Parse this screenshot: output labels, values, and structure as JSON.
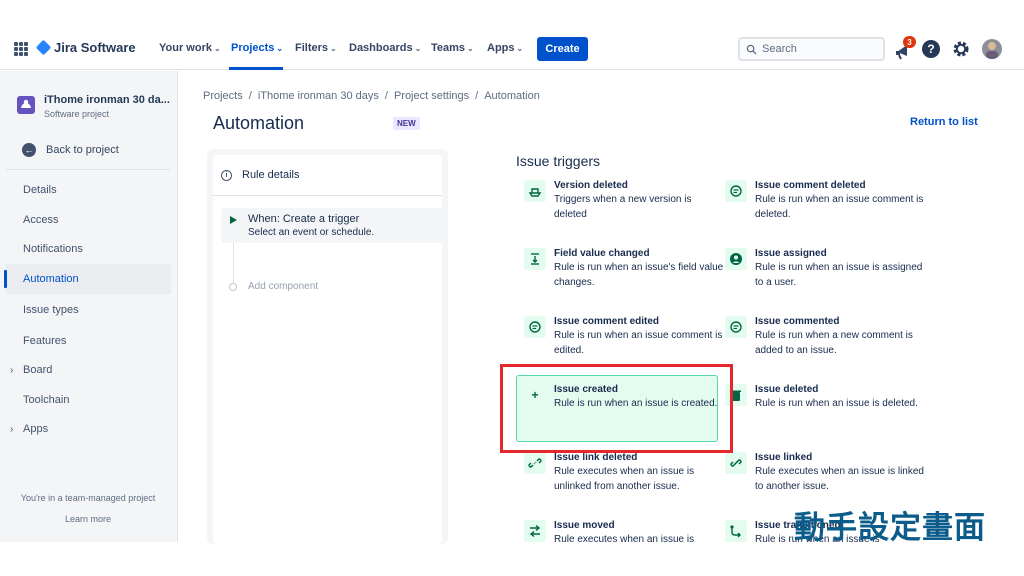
{
  "topnav": {
    "app_name": "Jira Software",
    "items": [
      {
        "label": "Your work",
        "has_chevron": true
      },
      {
        "label": "Projects",
        "has_chevron": true,
        "active": true
      },
      {
        "label": "Filters",
        "has_chevron": true
      },
      {
        "label": "Dashboards",
        "has_chevron": true
      },
      {
        "label": "Teams",
        "has_chevron": true
      },
      {
        "label": "Apps",
        "has_chevron": true
      }
    ],
    "create_label": "Create",
    "search_placeholder": "Search",
    "notification_count": "3",
    "help_symbol": "?",
    "accent_color": "#0052cc"
  },
  "sidebar": {
    "project_name": "iThome ironman 30 da...",
    "project_type": "Software project",
    "back_label": "Back to project",
    "items": [
      {
        "label": "Details"
      },
      {
        "label": "Access"
      },
      {
        "label": "Notifications"
      },
      {
        "label": "Automation",
        "active": true
      },
      {
        "label": "Issue types"
      },
      {
        "label": "Features"
      },
      {
        "label": "Board",
        "expandable": true
      },
      {
        "label": "Toolchain"
      },
      {
        "label": "Apps",
        "expandable": true
      }
    ],
    "team_note": "You're in a team-managed project",
    "learn_more": "Learn more"
  },
  "breadcrumb": [
    "Projects",
    "iThome ironman 30 days",
    "Project settings",
    "Automation"
  ],
  "page": {
    "title": "Automation",
    "badge": "NEW",
    "return_link": "Return to list"
  },
  "rule_panel": {
    "rule_details": "Rule details",
    "trigger_title": "When: Create a trigger",
    "trigger_subtitle": "Select an event or schedule.",
    "add_component": "Add component"
  },
  "triggers": {
    "heading": "Issue triggers",
    "items": [
      {
        "title": "Version deleted",
        "desc": "Triggers when a new version is deleted",
        "icon": "ship-icon"
      },
      {
        "title": "Issue comment deleted",
        "desc": "Rule is run when an issue comment is deleted.",
        "icon": "comment-icon"
      },
      {
        "title": "Field value changed",
        "desc": "Rule is run when an issue's field value changes.",
        "icon": "field-change-icon"
      },
      {
        "title": "Issue assigned",
        "desc": "Rule is run when an issue is assigned to a user.",
        "icon": "user-icon"
      },
      {
        "title": "Issue comment edited",
        "desc": "Rule is run when an issue comment is edited.",
        "icon": "comment-icon"
      },
      {
        "title": "Issue commented",
        "desc": "Rule is run when a new comment is added to an issue.",
        "icon": "comment-icon"
      },
      {
        "title": "Issue created",
        "desc": "Rule is run when an issue is created.",
        "icon": "plus-icon",
        "selected": true
      },
      {
        "title": "Issue deleted",
        "desc": "Rule is run when an issue is deleted.",
        "icon": "trash-icon"
      },
      {
        "title": "Issue link deleted",
        "desc": "Rule executes when an issue is unlinked from another issue.",
        "icon": "unlink-icon"
      },
      {
        "title": "Issue linked",
        "desc": "Rule executes when an issue is linked to another issue.",
        "icon": "link-icon"
      },
      {
        "title": "Issue moved",
        "desc": "Rule executes when an issue is",
        "icon": "move-icon"
      },
      {
        "title": "Issue transitioned",
        "desc": "Rule is run when an issue is",
        "icon": "transition-icon"
      }
    ]
  },
  "overlay_caption": "動手設定畫面"
}
